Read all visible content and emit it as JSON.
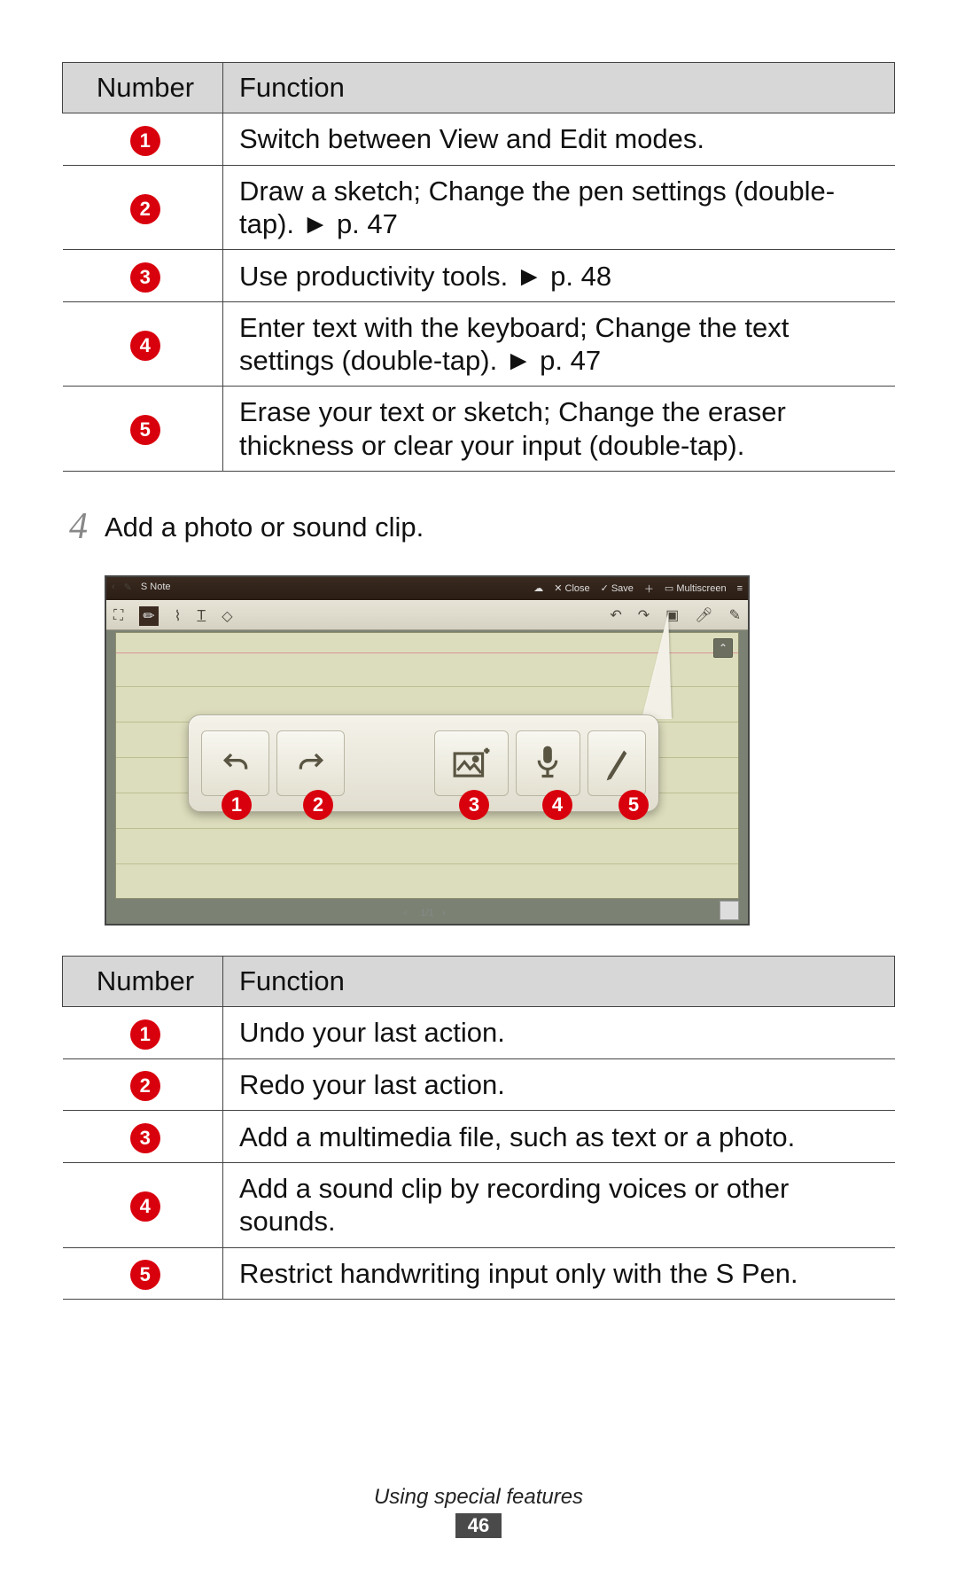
{
  "table1": {
    "header_num": "Number",
    "header_fn": "Function",
    "rows": [
      {
        "n": "1",
        "fn": "Switch between View and Edit modes."
      },
      {
        "n": "2",
        "fn": "Draw a sketch; Change the pen settings (double-tap). ► p. 47"
      },
      {
        "n": "3",
        "fn": "Use productivity tools. ► p. 48"
      },
      {
        "n": "4",
        "fn": "Enter text with the keyboard; Change the text settings (double-tap). ► p. 47"
      },
      {
        "n": "5",
        "fn": "Erase your text or sketch; Change the eraser thickness or clear your input (double-tap)."
      }
    ]
  },
  "step": {
    "num": "4",
    "text": "Add a photo or sound clip."
  },
  "screenshot": {
    "app_title": "S Note",
    "menu": {
      "close": "Close",
      "save": "Save",
      "multiscreen": "Multiscreen"
    },
    "paging": "1/1",
    "callouts": [
      "1",
      "2",
      "3",
      "4",
      "5"
    ]
  },
  "table2": {
    "header_num": "Number",
    "header_fn": "Function",
    "rows": [
      {
        "n": "1",
        "fn": "Undo your last action."
      },
      {
        "n": "2",
        "fn": "Redo your last action."
      },
      {
        "n": "3",
        "fn": "Add a multimedia file, such as text or a photo."
      },
      {
        "n": "4",
        "fn": "Add a sound clip by recording voices or other sounds."
      },
      {
        "n": "5",
        "fn": "Restrict handwriting input only with the S Pen."
      }
    ]
  },
  "footer": {
    "section": "Using special features",
    "page": "46"
  }
}
